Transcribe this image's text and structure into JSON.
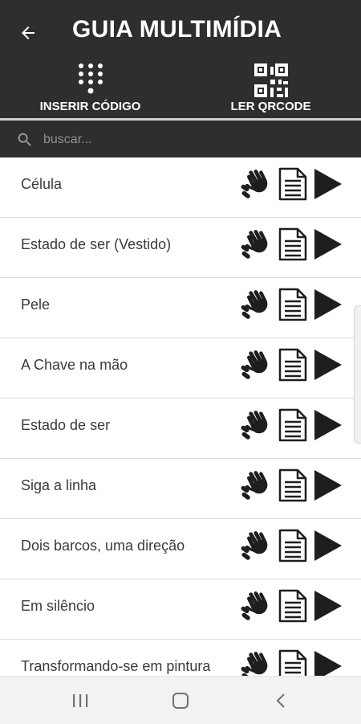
{
  "header": {
    "title": "GUIA MULTIMÍDIA",
    "back_icon": "arrow-left-icon",
    "actions": [
      {
        "label": "INSERIR CÓDIGO",
        "icon": "keypad-icon"
      },
      {
        "label": "LER QRCODE",
        "icon": "qrcode-icon"
      }
    ]
  },
  "search": {
    "placeholder": "buscar...",
    "value": "",
    "icon": "search-icon"
  },
  "items": [
    {
      "label": "Célula"
    },
    {
      "label": "Estado de ser (Vestido)"
    },
    {
      "label": "Pele"
    },
    {
      "label": "A Chave na mão"
    },
    {
      "label": "Estado de ser"
    },
    {
      "label": "Siga a linha"
    },
    {
      "label": "Dois barcos, uma direção"
    },
    {
      "label": "Em silêncio"
    },
    {
      "label": "Transformando-se em pintura"
    }
  ],
  "item_icons": [
    "sign-language-icon",
    "document-icon",
    "play-icon"
  ],
  "navbar": {
    "buttons": [
      "recent-apps-icon",
      "home-icon",
      "back-icon"
    ]
  },
  "colors": {
    "header_bg": "#2c2f2e",
    "text": "#3a3a3a",
    "icon": "#1e1e1e"
  }
}
